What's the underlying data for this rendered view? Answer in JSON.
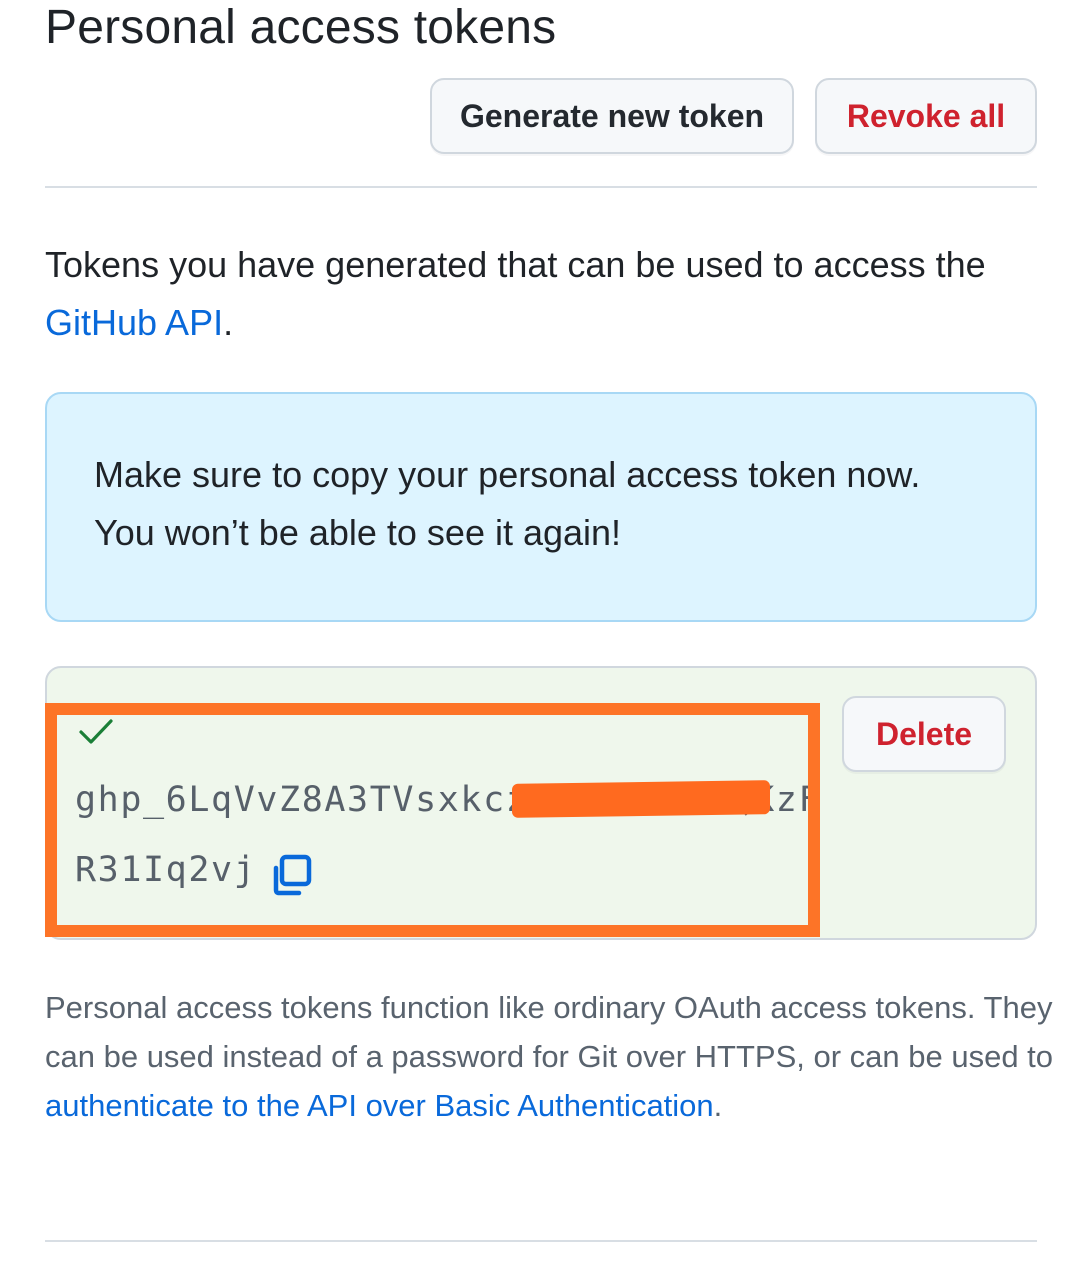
{
  "header": {
    "title": "Personal access tokens",
    "generate_label": "Generate new token",
    "revoke_label": "Revoke all"
  },
  "intro": {
    "text_before": "Tokens you have generated that can be used to access the ",
    "link_text": "GitHub API",
    "text_after": "."
  },
  "flash": {
    "line1": "Make sure to copy your personal access token now.",
    "line2": "You won’t be able to see it again!"
  },
  "token": {
    "line1_visible_start": "ghp_6LqVvZ8A3TVsxkcz",
    "line1_visible_end": "QKzF",
    "line2": "R31Iq2vj",
    "delete_label": "Delete",
    "status_icon": "check-icon",
    "copy_icon": "copy-icon"
  },
  "note": {
    "text_before": "Personal access tokens function like ordinary OAuth access tokens. They can be used instead of a password for Git over HTTPS, or can be used to ",
    "link_text": "authenticate to the API over Basic Authentication",
    "text_after": "."
  },
  "colors": {
    "accent_blue": "#0969da",
    "danger_red": "#cf222e",
    "success_green": "#1a7f37",
    "highlight_orange": "#fd7427",
    "flash_bg": "#ddf4ff",
    "token_bg": "#eff7ec"
  }
}
